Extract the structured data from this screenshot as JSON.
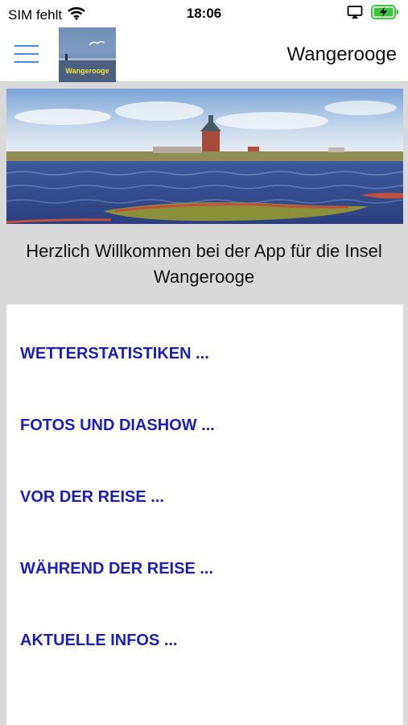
{
  "status_bar": {
    "carrier": "SIM fehlt",
    "time": "18:06",
    "icons": [
      "wifi-icon",
      "screen-mirroring-icon",
      "battery-charging-icon"
    ]
  },
  "header": {
    "title": "Wangerooge",
    "logo_text": "Wangerooge",
    "menu_icon": "hamburger-menu-icon"
  },
  "hero": {
    "description_icon": "island-landscape-photo"
  },
  "welcome_text": "Herzlich Willkommen bei der App für die Insel Wangerooge",
  "menu": {
    "items": [
      {
        "label": "WETTERSTATISTIKEN ..."
      },
      {
        "label": "FOTOS UND DIASHOW ..."
      },
      {
        "label": "VOR DER REISE ..."
      },
      {
        "label": "WÄHREND DER REISE ..."
      },
      {
        "label": "AKTUELLE INFOS ..."
      }
    ]
  },
  "colors": {
    "menu_link": "#1d1fb0",
    "hamburger": "#3c8fd8",
    "background": "#d9d9d9",
    "battery": "#3cc43c"
  }
}
